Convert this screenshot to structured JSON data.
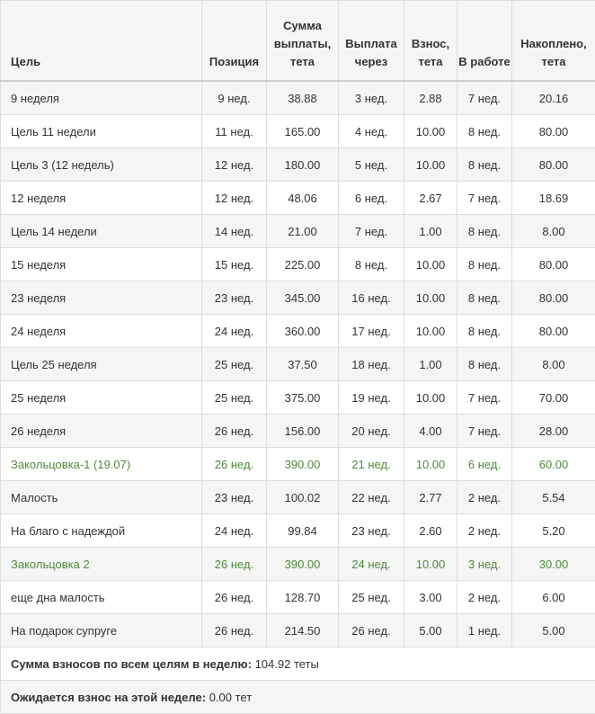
{
  "table": {
    "headers": [
      "Цель",
      "Позиция",
      "Сумма выплаты, тета",
      "Выплата через",
      "Взнос, тета",
      "В работе",
      "Накоплено, тета"
    ],
    "rows": [
      {
        "name": "9 неделя",
        "position": "9 нед.",
        "payout": "38.88",
        "due": "3 нед.",
        "contribution": "2.88",
        "in_work": "7 нед.",
        "accumulated": "20.16",
        "active": false
      },
      {
        "name": "Цель 11 недели",
        "position": "11 нед.",
        "payout": "165.00",
        "due": "4 нед.",
        "contribution": "10.00",
        "in_work": "8 нед.",
        "accumulated": "80.00",
        "active": false
      },
      {
        "name": "Цель 3 (12 недель)",
        "position": "12 нед.",
        "payout": "180.00",
        "due": "5 нед.",
        "contribution": "10.00",
        "in_work": "8 нед.",
        "accumulated": "80.00",
        "active": false
      },
      {
        "name": "12 неделя",
        "position": "12 нед.",
        "payout": "48.06",
        "due": "6 нед.",
        "contribution": "2.67",
        "in_work": "7 нед.",
        "accumulated": "18.69",
        "active": false
      },
      {
        "name": "Цель 14 недели",
        "position": "14 нед.",
        "payout": "21.00",
        "due": "7 нед.",
        "contribution": "1.00",
        "in_work": "8 нед.",
        "accumulated": "8.00",
        "active": false
      },
      {
        "name": "15 неделя",
        "position": "15 нед.",
        "payout": "225.00",
        "due": "8 нед.",
        "contribution": "10.00",
        "in_work": "8 нед.",
        "accumulated": "80.00",
        "active": false
      },
      {
        "name": "23 неделя",
        "position": "23 нед.",
        "payout": "345.00",
        "due": "16 нед.",
        "contribution": "10.00",
        "in_work": "8 нед.",
        "accumulated": "80.00",
        "active": false
      },
      {
        "name": "24 неделя",
        "position": "24 нед.",
        "payout": "360.00",
        "due": "17 нед.",
        "contribution": "10.00",
        "in_work": "8 нед.",
        "accumulated": "80.00",
        "active": false
      },
      {
        "name": "Цель 25 неделя",
        "position": "25 нед.",
        "payout": "37.50",
        "due": "18 нед.",
        "contribution": "1.00",
        "in_work": "8 нед.",
        "accumulated": "8.00",
        "active": false
      },
      {
        "name": "25 неделя",
        "position": "25 нед.",
        "payout": "375.00",
        "due": "19 нед.",
        "contribution": "10.00",
        "in_work": "7 нед.",
        "accumulated": "70.00",
        "active": false
      },
      {
        "name": "26 неделя",
        "position": "26 нед.",
        "payout": "156.00",
        "due": "20 нед.",
        "contribution": "4.00",
        "in_work": "7 нед.",
        "accumulated": "28.00",
        "active": false
      },
      {
        "name": "Закольцовка-1 (19.07)",
        "position": "26 нед.",
        "payout": "390.00",
        "due": "21 нед.",
        "contribution": "10.00",
        "in_work": "6 нед.",
        "accumulated": "60.00",
        "active": true
      },
      {
        "name": "Малость",
        "position": "23 нед.",
        "payout": "100.02",
        "due": "22 нед.",
        "contribution": "2.77",
        "in_work": "2 нед.",
        "accumulated": "5.54",
        "active": false
      },
      {
        "name": "На благо с надеждой",
        "position": "24 нед.",
        "payout": "99.84",
        "due": "23 нед.",
        "contribution": "2.60",
        "in_work": "2 нед.",
        "accumulated": "5.20",
        "active": false
      },
      {
        "name": "Закольцовка 2",
        "position": "26 нед.",
        "payout": "390.00",
        "due": "24 нед.",
        "contribution": "10.00",
        "in_work": "3 нед.",
        "accumulated": "30.00",
        "active": true
      },
      {
        "name": "еще дна малость",
        "position": "26 нед.",
        "payout": "128.70",
        "due": "25 нед.",
        "contribution": "3.00",
        "in_work": "2 нед.",
        "accumulated": "6.00",
        "active": false
      },
      {
        "name": "На подарок супруге",
        "position": "26 нед.",
        "payout": "214.50",
        "due": "26 нед.",
        "contribution": "5.00",
        "in_work": "1 нед.",
        "accumulated": "5.00",
        "active": false
      }
    ]
  },
  "summary": {
    "weekly_label": "Сумма взносов по всем целям в неделю:",
    "weekly_value": "104.92 теты",
    "expected_label": "Ожидается взнос на этой неделе:",
    "expected_value": "0.00 тет"
  },
  "colors": {
    "active_row_text": "#4f8a3a",
    "stripe": "#f5f5f5",
    "border": "#dddddd"
  }
}
